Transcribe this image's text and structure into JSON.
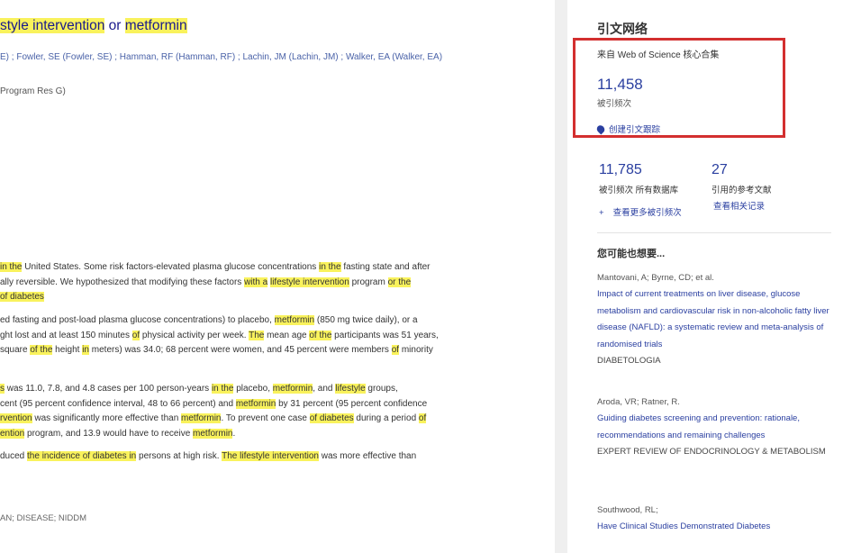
{
  "article": {
    "title_parts": [
      "style intervention",
      " or ",
      "metformin"
    ],
    "authors": "E) ; Fowler, SE (Fowler, SE) ; Hamman, RF (Hamman, RF) ; Lachin, JM (Lachin, JM) ; Walker, EA (Walker, EA)",
    "journal": "Program Res G)"
  },
  "abstract": {
    "p1_l1": [
      "in the",
      "United States. Some risk factors-elevated plasma glucose concentrations",
      "in the",
      "fasting state and after"
    ],
    "p1_l2": [
      "ally reversible. We hypothesized that modifying these factors ",
      "with a",
      " ",
      "lifestyle intervention",
      " program ",
      "or the"
    ],
    "p1_l3": [
      "of diabetes"
    ],
    "p2_l1": [
      "ed fasting and post-load plasma glucose concentrations) to placebo, ",
      "metformin",
      " (850 mg twice daily), or a"
    ],
    "p2_l2": [
      "ght lost and at least 150 minutes ",
      "of",
      " physical activity per week. ",
      "The",
      " mean age ",
      "of the",
      " participants was 51 years,"
    ],
    "p2_l3": [
      "square ",
      "of the",
      " height ",
      "in",
      " meters) was 34.0; 68 percent were women, and 45 percent were members ",
      "of",
      " minority"
    ],
    "p3_l1": [
      "s",
      " was 11.0, 7.8, and 4.8 cases per 100 person-years ",
      "in the",
      " placebo, ",
      "metformin",
      ", and ",
      "lifestyle",
      " groups,"
    ],
    "p3_l2": [
      "cent (95 percent confidence interval, 48 to 66 percent) and ",
      "metformin",
      " by 31 percent (95 percent confidence"
    ],
    "p3_l3": [
      "rvention",
      " was significantly more effective than ",
      "metformin",
      ". To prevent one case ",
      "of diabetes",
      " during a period ",
      "of"
    ],
    "p3_l4": [
      "ention",
      " program, and 13.9 would have to receive ",
      "metformin",
      "."
    ],
    "p4_l1": [
      "duced ",
      "the incidence of diabetes in",
      " persons at high risk. ",
      "The lifestyle intervention",
      " was more effective than"
    ],
    "keywords": "AN; DISEASE; NIDDM"
  },
  "sidebar": {
    "title": "引文网络",
    "wos_label": "来自 Web of Science 核心合集",
    "wos_count": "11,458",
    "wos_sub": "被引频次",
    "alert": "创建引文跟踪",
    "total_count": "11,785",
    "total_label": "被引频次 所有数据库",
    "refs_count": "27",
    "refs_label": "引用的参考文献",
    "more_link": "查看更多被引频次",
    "related_link": "查看相关记录",
    "related_heading": "您可能也想要...",
    "refs": [
      {
        "authors": "Mantovani, A; Byrne, CD; et al.",
        "title": "Impact of current treatments on liver disease, glucose metabolism and cardiovascular risk in non-alcoholic fatty liver disease (NAFLD): a systematic review and meta-analysis of randomised trials",
        "journal": "DIABETOLOGIA"
      },
      {
        "authors": "Aroda, VR; Ratner, R.",
        "title": "Guiding diabetes screening and prevention: rationale, recommendations and remaining challenges",
        "journal": "EXPERT REVIEW OF ENDOCRINOLOGY & METABOLISM"
      },
      {
        "authors": "Southwood, RL;",
        "title": "Have Clinical Studies Demonstrated Diabetes",
        "journal": ""
      }
    ]
  },
  "colors": {
    "highlight": "#f9f25c",
    "link": "#2a3fa0",
    "box": "#d32f2f"
  }
}
